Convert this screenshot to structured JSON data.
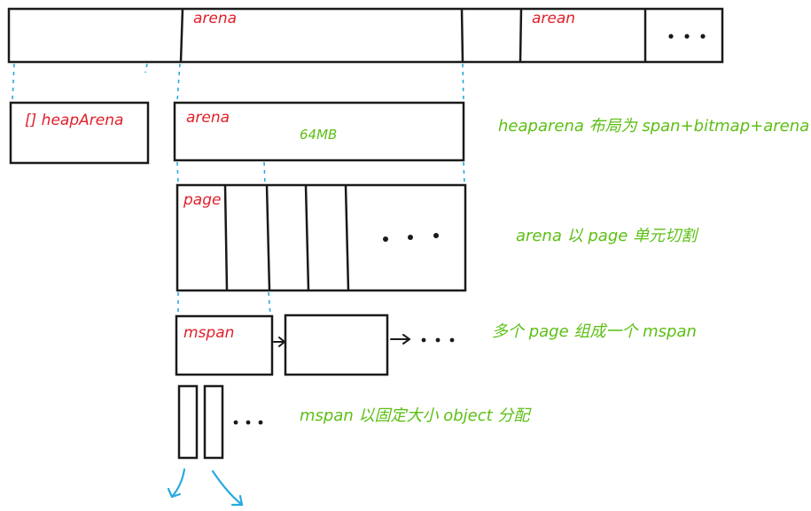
{
  "labels": {
    "top_arena": "arena",
    "top_arean": "arean",
    "heaparena_array": "[] heapArena",
    "arena_box": "arena",
    "arena_size": "64MB",
    "page": "page",
    "mspan": "mspan"
  },
  "notes": {
    "heaparena_layout": "heaparena 布局为 span+bitmap+arena",
    "arena_split": "arena 以 page 单元切割",
    "pages_to_mspan": "多个 page 组成一个 mspan",
    "mspan_objects": "mspan 以固定大小 object 分配"
  },
  "colors": {
    "label_red": "#e0202a",
    "note_green": "#5cbf14",
    "guide_blue": "#29a9e0",
    "stroke": "#1a1a1a"
  }
}
